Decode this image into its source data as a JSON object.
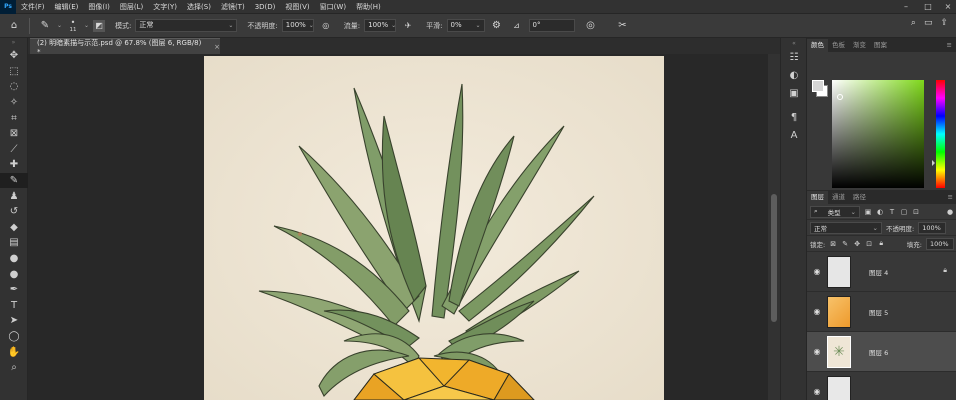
{
  "menubar": {
    "items": [
      "文件(F)",
      "编辑(E)",
      "图像(I)",
      "图层(L)",
      "文字(Y)",
      "选择(S)",
      "滤镜(T)",
      "3D(D)",
      "视图(V)",
      "窗口(W)",
      "帮助(H)"
    ],
    "logo": "Ps"
  },
  "options": {
    "brush_size": "11",
    "mode_label": "模式:",
    "mode_value": "正常",
    "opacity_label": "不透明度:",
    "opacity_value": "100%",
    "flow_label": "流量:",
    "flow_value": "100%",
    "smooth_label": "平滑:",
    "smooth_value": "0%",
    "angle_value": "0°"
  },
  "document": {
    "tab_title": "(2) 明暗素描与示范.psd @ 67.8% (图层 6, RGB/8) *",
    "close_symbol": "×"
  },
  "color_panel": {
    "tabs": [
      "颜色",
      "色板",
      "渐变",
      "图案"
    ],
    "active_tab": 0,
    "hue_color": "#7fd81b"
  },
  "layers_panel": {
    "tabs": [
      "图层",
      "通道",
      "路径"
    ],
    "active_tab": 0,
    "filter_kind": "类型",
    "blend_mode": "正常",
    "opacity_label": "不透明度:",
    "opacity_value": "100%",
    "lock_label": "锁定:",
    "fill_label": "填充:",
    "fill_value": "100%",
    "layers": [
      {
        "name": "图层 4",
        "visible": true,
        "locked": true,
        "thumb": "#e6e6e6"
      },
      {
        "name": "图层 5",
        "visible": true,
        "locked": false,
        "thumb": "#f0a640"
      },
      {
        "name": "图层 6",
        "visible": true,
        "locked": false,
        "thumb": "#efe6d6",
        "active": true
      },
      {
        "name": "",
        "visible": true,
        "locked": false,
        "thumb": "#e8e8e8"
      }
    ]
  },
  "colors": {
    "pineapple_leaf": "#6f8f5a",
    "pineapple_body": "#f2b52e",
    "paper": "#efe6d6"
  }
}
